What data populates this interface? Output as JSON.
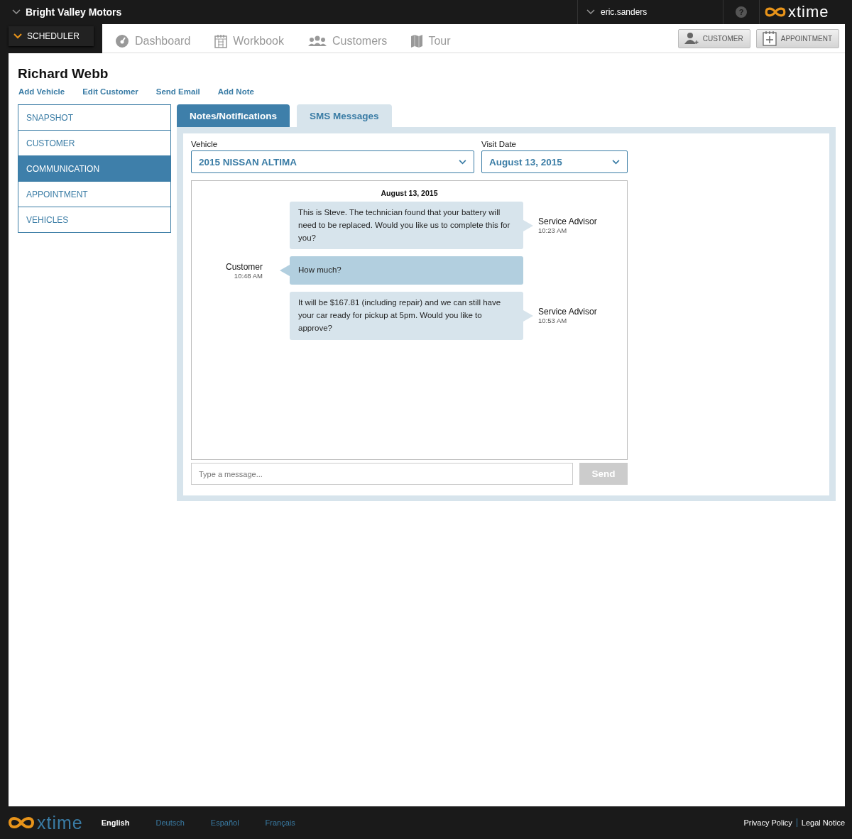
{
  "top_bar": {
    "dealer": "Bright Valley Motors",
    "user": "eric.sanders",
    "help": "?",
    "logo": "xtime"
  },
  "app_menu": {
    "label": "SCHEDULER"
  },
  "nav": [
    {
      "label": "Dashboard"
    },
    {
      "label": "Workbook"
    },
    {
      "label": "Customers"
    },
    {
      "label": "Tour"
    }
  ],
  "actions": [
    {
      "label": "CUSTOMER"
    },
    {
      "label": "APPOINTMENT"
    }
  ],
  "customer": {
    "name": "Richard Webb",
    "links": [
      "Add Vehicle",
      "Edit Customer",
      "Send Email",
      "Add Note"
    ]
  },
  "sidebar": {
    "items": [
      {
        "label": "SNAPSHOT",
        "selected": false
      },
      {
        "label": "CUSTOMER",
        "selected": false
      },
      {
        "label": "COMMUNICATION",
        "selected": true
      },
      {
        "label": "APPOINTMENT",
        "selected": false
      },
      {
        "label": "VEHICLES",
        "selected": false
      }
    ]
  },
  "tabs": [
    {
      "label": "Notes/Notifications",
      "selected": true
    },
    {
      "label": "SMS Messages",
      "selected": false
    }
  ],
  "vehicle": {
    "label": "Vehicle",
    "value": "2015 NISSAN ALTIMA"
  },
  "visit_date": {
    "label": "Visit Date",
    "value": "August 13, 2015"
  },
  "conversation": {
    "date": "August 13, 2015",
    "messages": [
      {
        "kind": "outgoing",
        "text": "This is Steve. The technician found that your battery will need to be replaced. Would you like us to complete this for you?",
        "sender": "Service Advisor",
        "time": "10:23 AM"
      },
      {
        "kind": "incoming",
        "text": "How much?",
        "sender": "Customer",
        "time": "10:48 AM"
      },
      {
        "kind": "outgoing",
        "text": "It will be $167.81 (including repair) and we can still have your car ready for pickup at 5pm. Would you like to approve?",
        "sender": "Service Advisor",
        "time": "10:53 AM"
      }
    ]
  },
  "composer": {
    "placeholder": "Type a message...",
    "send": "Send"
  },
  "footer": {
    "logo": "xtime",
    "languages": [
      {
        "label": "English",
        "selected": true
      },
      {
        "label": "Deutsch",
        "selected": false
      },
      {
        "label": "Español",
        "selected": false
      },
      {
        "label": "Français",
        "selected": false
      }
    ],
    "links": [
      "Privacy Policy",
      "Legal Notice"
    ]
  }
}
